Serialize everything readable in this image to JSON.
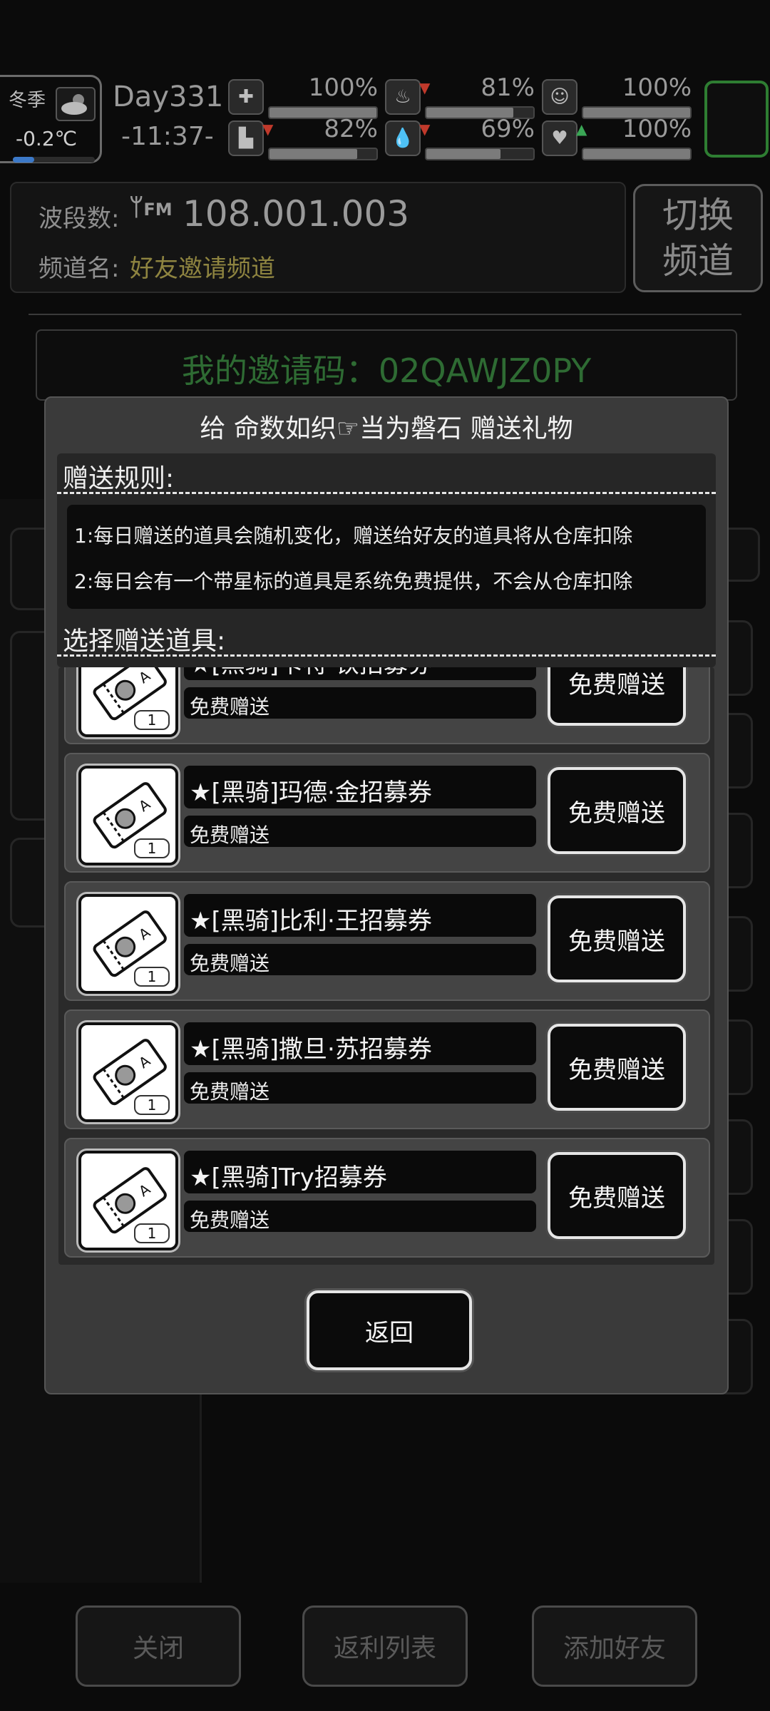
{
  "status": {
    "season": "冬季",
    "temperature": "-0.2℃",
    "day": "Day331",
    "time": "-11:37-",
    "stats": [
      {
        "name": "health",
        "icon": "medkit-icon",
        "percent_text": "100%",
        "level": 1.0,
        "arrow": ""
      },
      {
        "name": "hunger",
        "icon": "stomach-icon",
        "percent_text": "81%",
        "level": 0.81,
        "arrow": "down"
      },
      {
        "name": "mood",
        "icon": "face-icon",
        "percent_text": "100%",
        "level": 1.0,
        "arrow": ""
      },
      {
        "name": "stamina",
        "icon": "boot-icon",
        "percent_text": "82%",
        "level": 0.82,
        "arrow": "down"
      },
      {
        "name": "thirst",
        "icon": "water-drop-icon",
        "percent_text": "69%",
        "level": 0.69,
        "arrow": "down"
      },
      {
        "name": "heart",
        "icon": "heart-icon",
        "percent_text": "100%",
        "level": 1.0,
        "arrow": "up"
      }
    ]
  },
  "radio": {
    "band_label": "波段数:",
    "band_icon_text": "FM",
    "frequency": "108.001.003",
    "channel_label": "频道名:",
    "channel_name": "好友邀请频道",
    "switch_label_1": "切换",
    "switch_label_2": "频道"
  },
  "invite": {
    "text": "我的邀请码：02QAWJZ0PY"
  },
  "dialog": {
    "title": "给 命数如织☞当为磐石 赠送礼物",
    "rules_heading": "赠送规则:",
    "rules": [
      "1:每日赠送的道具会随机变化，赠送给好友的道具将从仓库扣除",
      "2:每日会有一个带星标的道具是系统免费提供，不会从仓库扣除"
    ],
    "select_heading": "选择赠送道具:",
    "items": [
      {
        "name": "★[黑骑]卡特·铁招募券",
        "desc": "免费赠送",
        "count": "1",
        "button": "免费赠送"
      },
      {
        "name": "★[黑骑]玛德·金招募券",
        "desc": "免费赠送",
        "count": "1",
        "button": "免费赠送"
      },
      {
        "name": "★[黑骑]比利·王招募券",
        "desc": "免费赠送",
        "count": "1",
        "button": "免费赠送"
      },
      {
        "name": "★[黑骑]撒旦·苏招募券",
        "desc": "免费赠送",
        "count": "1",
        "button": "免费赠送"
      },
      {
        "name": "★[黑骑]Try招募券",
        "desc": "免费赠送",
        "count": "1",
        "button": "免费赠送"
      }
    ],
    "return_label": "返回"
  },
  "bottom": {
    "close": "关闭",
    "rebate_list": "返利列表",
    "add_friend": "添加好友"
  }
}
